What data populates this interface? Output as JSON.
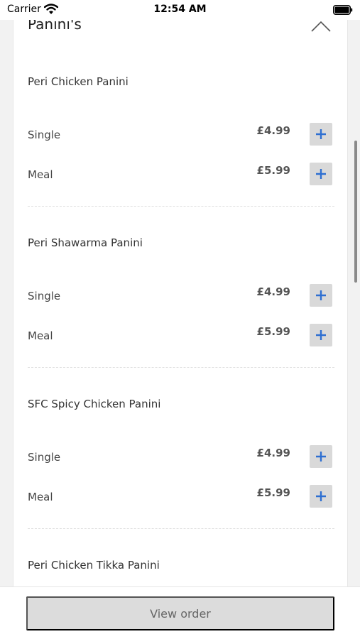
{
  "status_bar": {
    "carrier": "Carrier",
    "time": "12:54 AM"
  },
  "section": {
    "title": "Panini's"
  },
  "products": [
    {
      "name": "Peri Chicken Panini",
      "options": [
        {
          "label": "Single",
          "price": "£4.99"
        },
        {
          "label": "Meal",
          "price": "£5.99"
        }
      ]
    },
    {
      "name": "Peri Shawarma Panini",
      "options": [
        {
          "label": "Single",
          "price": "£4.99"
        },
        {
          "label": "Meal",
          "price": "£5.99"
        }
      ]
    },
    {
      "name": "SFC Spicy Chicken Panini",
      "options": [
        {
          "label": "Single",
          "price": "£4.99"
        },
        {
          "label": "Meal",
          "price": "£5.99"
        }
      ]
    },
    {
      "name": "Peri Chicken Tikka Panini",
      "options": []
    }
  ],
  "footer": {
    "view_order_label": "View order"
  },
  "colors": {
    "accent": "#2e6fd1",
    "button_bg": "#d9d9d9"
  },
  "icons": {
    "wifi": "wifi-icon",
    "battery": "battery-icon",
    "collapse": "chevron-up-icon",
    "add": "plus-icon"
  }
}
